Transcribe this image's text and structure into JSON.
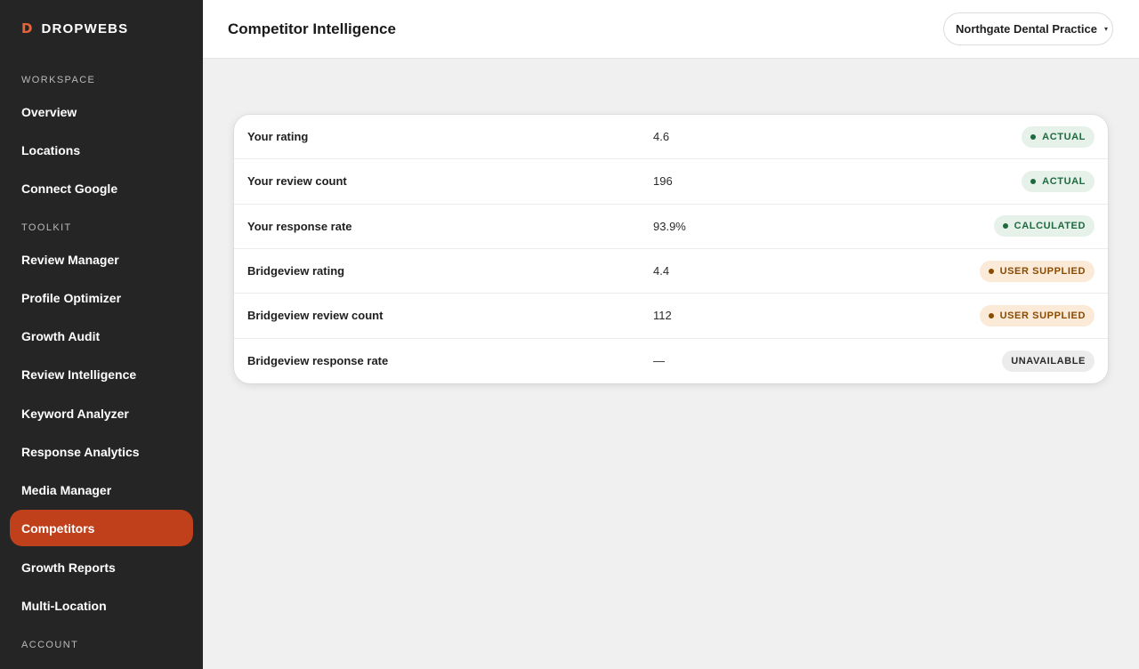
{
  "brand": {
    "mark": "D",
    "name": "DROPWEBS"
  },
  "sidebar": {
    "sections": [
      {
        "label": "WORKSPACE"
      },
      {
        "label": "TOOLKIT"
      },
      {
        "label": "ACCOUNT"
      }
    ],
    "items": [
      {
        "label": "Overview"
      },
      {
        "label": "Locations"
      },
      {
        "label": "Connect Google"
      },
      {
        "label": "Review Manager"
      },
      {
        "label": "Profile Optimizer"
      },
      {
        "label": "Growth Audit"
      },
      {
        "label": "Review Intelligence"
      },
      {
        "label": "Keyword Analyzer"
      },
      {
        "label": "Response Analytics"
      },
      {
        "label": "Media Manager"
      },
      {
        "label": "Competitors",
        "active": true
      },
      {
        "label": "Growth Reports"
      },
      {
        "label": "Multi-Location"
      }
    ]
  },
  "header": {
    "title": "Competitor Intelligence",
    "location_select": {
      "value": "Northgate Dental Practice",
      "caret": "▾"
    }
  },
  "metrics": [
    {
      "metric": "Your rating",
      "value": "4.6",
      "badge": "ACTUAL",
      "status": "actual"
    },
    {
      "metric": "Your review count",
      "value": "196",
      "badge": "ACTUAL",
      "status": "actual"
    },
    {
      "metric": "Your response rate",
      "value": "93.9%",
      "badge": "CALCULATED",
      "status": "calculated"
    },
    {
      "metric": "Bridgeview rating",
      "value": "4.4",
      "badge": "USER SUPPLIED",
      "status": "user"
    },
    {
      "metric": "Bridgeview review count",
      "value": "112",
      "badge": "USER SUPPLIED",
      "status": "user"
    },
    {
      "metric": "Bridgeview response rate",
      "value": "—",
      "badge": "UNAVAILABLE",
      "status": "unavailable"
    }
  ],
  "colors": {
    "sidebar_bg": "#252525",
    "accent": "#c0401c",
    "brand_mark": "#e8643a",
    "status_green": "#1e6a3e",
    "status_amber": "#8a4a00"
  }
}
